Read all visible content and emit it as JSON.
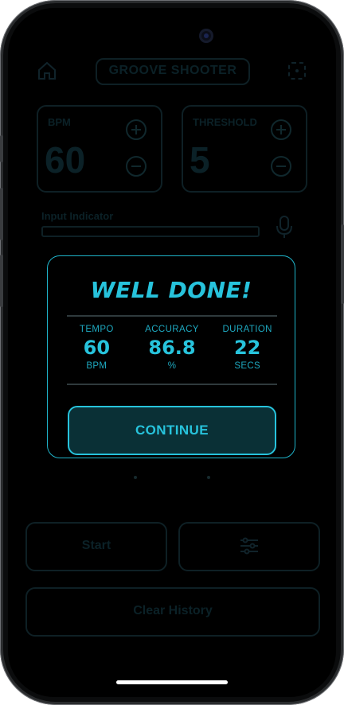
{
  "app": {
    "title": "GROOVE SHOOTER",
    "icons": [
      "home-icon",
      "target-icon",
      "microphone-icon",
      "sliders-icon"
    ]
  },
  "controls": {
    "bpm_label": "BPM",
    "bpm_value": "60",
    "threshold_label": "THRESHOLD",
    "threshold_value": "5",
    "input_indicator_label": "Input Indicator"
  },
  "actions": {
    "start_label": "Start",
    "clear_history_label": "Clear History"
  },
  "modal": {
    "title": "WELL DONE!",
    "stats": [
      {
        "label": "TEMPO",
        "value": "60",
        "unit": "BPM"
      },
      {
        "label": "ACCURACY",
        "value": "86.8",
        "unit": "%"
      },
      {
        "label": "DURATION",
        "value": "22",
        "unit": "SECS"
      }
    ],
    "continue_label": "CONTINUE"
  },
  "colors": {
    "accent": "#27c3dc",
    "button_bg": "#0a3036",
    "background": "#000000"
  }
}
